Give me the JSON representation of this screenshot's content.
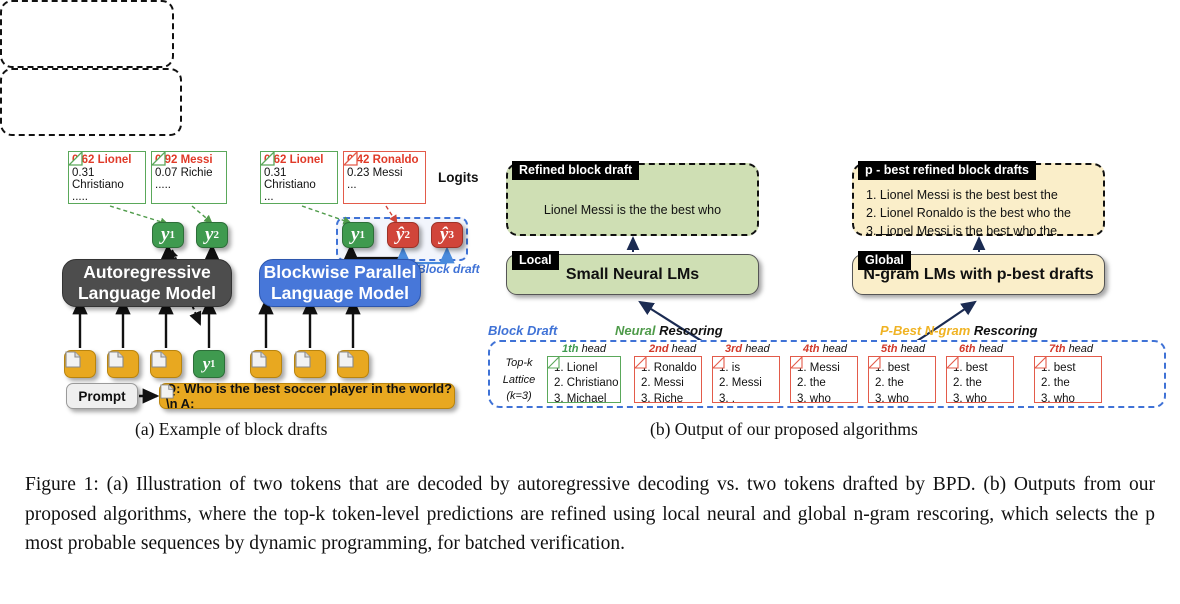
{
  "panel_a": {
    "subcaption": "(a) Example of block drafts",
    "logits_label": "Logits",
    "block_draft_label": "Block draft",
    "ar_model_line1": "Autoregressive",
    "ar_model_line2": "Language Model",
    "bp_model_line1": "Blockwise Parallel",
    "bp_model_line2": "Language Model",
    "prompt_label": "Prompt",
    "prompt_text": "Q: Who is the best soccer player in the world? \\n A:",
    "logit_cards": [
      {
        "top": "0.62 Lionel",
        "second": "0.31 Christiano",
        "ellipsis": ".....",
        "color": "green"
      },
      {
        "top": "0.92 Messi",
        "second": "0.07 Richie",
        "ellipsis": ".....",
        "color": "green"
      },
      {
        "top": "0.62 Lionel",
        "second": "0.31 Christiano",
        "ellipsis": "...",
        "color": "green"
      },
      {
        "top": "0.42 Ronaldo",
        "second": "0.23 Messi",
        "ellipsis": "...",
        "color": "red"
      }
    ],
    "tokens_ar": [
      {
        "text": "y",
        "sub": "1",
        "color": "green"
      },
      {
        "text": "y",
        "sub": "2",
        "color": "green"
      }
    ],
    "tokens_bp": [
      {
        "text": "y",
        "sub": "1",
        "color": "green"
      },
      {
        "text": "ŷ",
        "sub": "2",
        "color": "red"
      },
      {
        "text": "ŷ",
        "sub": "3",
        "color": "red"
      }
    ],
    "feedback_token": {
      "text": "y",
      "sub": "1",
      "color": "green"
    }
  },
  "panel_b": {
    "subcaption": "(b) Output of our proposed algorithms",
    "refined_tag": "Refined block draft",
    "refined_text": "Lionel Messi is the the best who",
    "local_tag": "Local",
    "local_box": "Small Neural LMs",
    "pbest_tag": "p - best refined block drafts",
    "pbest_drafts": [
      "1. Lionel Messi is the best best the",
      "2. Lionel Ronaldo is the best who the",
      "3. Lionel Messi is the best who the"
    ],
    "global_tag": "Global",
    "global_box": "N-gram LMs with p-best drafts",
    "section_labels": {
      "block_draft": "Block Draft",
      "neural_colored": "Neural",
      "neural_plain": "Rescoring",
      "ngram_colored": "P-Best N-gram",
      "ngram_plain": "Rescoring"
    },
    "topk_lattice": [
      "Top-k",
      "Lattice",
      "(k=3)"
    ],
    "heads": [
      {
        "ordinal": "1th",
        "word": "head",
        "accent": "green",
        "items": [
          "1. Lionel",
          "2. Christiano",
          "3. Michael"
        ],
        "border": "green"
      },
      {
        "ordinal": "2nd",
        "word": "head",
        "accent": "red",
        "items": [
          "1. Ronaldo",
          "2. Messi",
          "3. Riche"
        ],
        "border": "red"
      },
      {
        "ordinal": "3rd",
        "word": "head",
        "accent": "red",
        "items": [
          "1. is",
          "2. Messi",
          "3. ,"
        ],
        "border": "red"
      },
      {
        "ordinal": "4th",
        "word": "head",
        "accent": "red",
        "items": [
          "1. Messi",
          "2. the",
          "3. who"
        ],
        "border": "red"
      },
      {
        "ordinal": "5th",
        "word": "head",
        "accent": "red",
        "items": [
          "1. best",
          "2. the",
          "3. who"
        ],
        "border": "red"
      },
      {
        "ordinal": "6th",
        "word": "head",
        "accent": "red",
        "items": [
          "1. best",
          "2. the",
          "3. who"
        ],
        "border": "red"
      },
      {
        "ordinal": "7th",
        "word": "head",
        "accent": "red",
        "items": [
          "1. best",
          "2. the",
          "3. who"
        ],
        "border": "red"
      }
    ]
  },
  "figure_caption": {
    "prefix": "Figure 1:",
    "text": "Figure 1: (a) Illustration of two tokens that are decoded by autoregressive decoding vs. two tokens drafted by BPD. (b) Outputs from our proposed algorithms, where the top-k token-level predictions are refined using local neural and global n-gram rescoring, which selects the p most probable sequences by dynamic programming, for batched verification."
  },
  "colors": {
    "green_fill": "#3f9a4f",
    "red_fill": "#d1453a",
    "blue_model": "#4777d9",
    "dark_model": "#4d4d4d",
    "gold": "#e8a820",
    "green_pale": "#cfdfb4",
    "cream": "#faeec9",
    "blue_dash": "#3f72d6",
    "arrow_navy": "#1b2b52"
  }
}
